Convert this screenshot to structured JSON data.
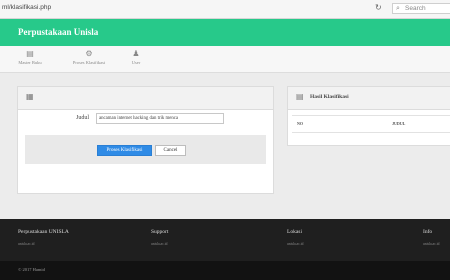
{
  "browser": {
    "url": "ml/klasifikasi.php",
    "search_placeholder": "Search"
  },
  "navbar": {
    "brand": "Perpustakaan Unisla"
  },
  "menu": {
    "items": [
      {
        "label": "Master Buku",
        "icon": "book-icon"
      },
      {
        "label": "Proses Klasifikasi",
        "icon": "gears-icon"
      },
      {
        "label": "User",
        "icon": "user-icon"
      }
    ]
  },
  "form_panel": {
    "title": "",
    "judul_label": "Judul",
    "judul_value": "ancaman internet hacking dan trik menca",
    "submit_label": "Proses Klasifikasi",
    "cancel_label": "Cancel"
  },
  "result_panel": {
    "title": "Hasil Klasifikasi",
    "columns": [
      "NO",
      "JUDUL"
    ]
  },
  "footer": {
    "columns": [
      {
        "title": "Perpustakaan UNISLA",
        "link": "unisla.ac.id"
      },
      {
        "title": "Support",
        "link": "unisla.ac.id"
      },
      {
        "title": "Lokasi",
        "link": "unisla.ac.id"
      },
      {
        "title": "Info",
        "link": "unisla.ac.id"
      }
    ],
    "copyright": "© 2017 Hamid"
  }
}
